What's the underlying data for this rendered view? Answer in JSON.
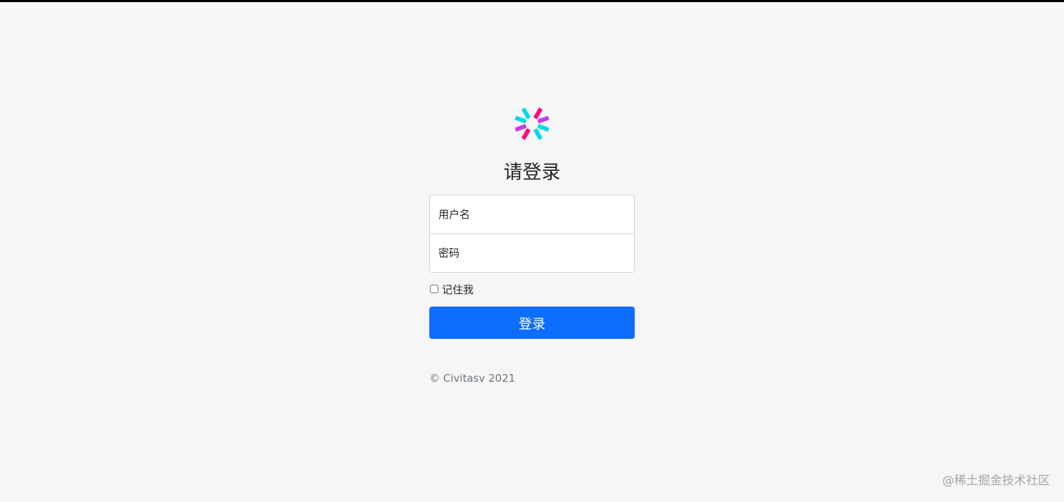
{
  "colors": {
    "background": "#f6f6f6",
    "primary": "#0d6efd",
    "logo_cyan": "#00d9e9",
    "logo_pink": "#ff0a78",
    "logo_purple": "#c63ce9"
  },
  "form": {
    "logo_icon": "pinwheel-logo-icon",
    "title": "请登录",
    "username_placeholder": "用户名",
    "password_placeholder": "密码",
    "remember_label": "记住我",
    "remember_checked": false,
    "submit_label": "登录"
  },
  "footer": {
    "copyright": "© Civitasv 2021"
  },
  "watermark": {
    "text": "@稀土掘金技术社区"
  }
}
